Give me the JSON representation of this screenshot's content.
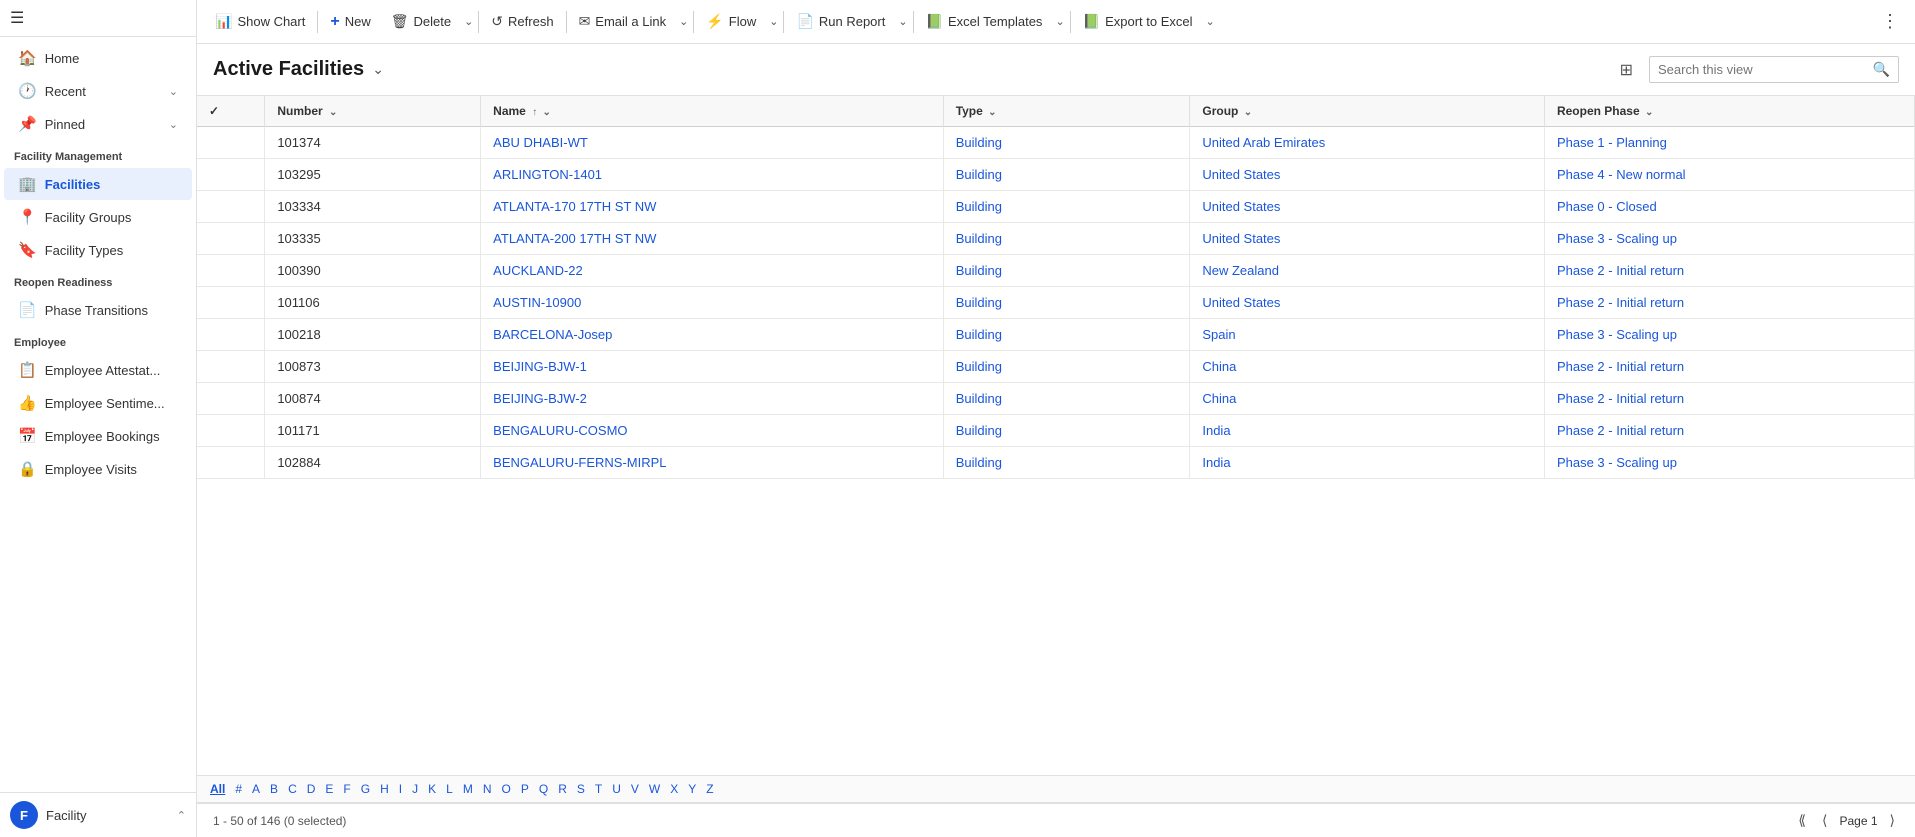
{
  "sidebar": {
    "hamburger_icon": "☰",
    "nav_items": [
      {
        "id": "home",
        "label": "Home",
        "icon": "🏠",
        "has_chevron": false
      },
      {
        "id": "recent",
        "label": "Recent",
        "icon": "🕐",
        "has_chevron": true
      },
      {
        "id": "pinned",
        "label": "Pinned",
        "icon": "📌",
        "has_chevron": true
      }
    ],
    "sections": [
      {
        "title": "Facility Management",
        "items": [
          {
            "id": "facilities",
            "label": "Facilities",
            "icon": "🏢",
            "active": true
          },
          {
            "id": "facility-groups",
            "label": "Facility Groups",
            "icon": "📍"
          },
          {
            "id": "facility-types",
            "label": "Facility Types",
            "icon": "🔖"
          }
        ]
      },
      {
        "title": "Reopen Readiness",
        "items": [
          {
            "id": "phase-transitions",
            "label": "Phase Transitions",
            "icon": "📄"
          }
        ]
      },
      {
        "title": "Employee",
        "items": [
          {
            "id": "employee-attestat",
            "label": "Employee Attestat...",
            "icon": "📋"
          },
          {
            "id": "employee-sentime",
            "label": "Employee Sentime...",
            "icon": "👍"
          },
          {
            "id": "employee-bookings",
            "label": "Employee Bookings",
            "icon": "📅"
          },
          {
            "id": "employee-visits",
            "label": "Employee Visits",
            "icon": "🔒"
          }
        ]
      }
    ],
    "footer": {
      "avatar_letter": "F",
      "label": "Facility",
      "chevron": "⌃"
    }
  },
  "toolbar": {
    "buttons": [
      {
        "id": "show-chart",
        "icon": "📊",
        "label": "Show Chart",
        "has_chevron": false
      },
      {
        "id": "new",
        "icon": "+",
        "label": "New",
        "has_chevron": false
      },
      {
        "id": "delete",
        "icon": "🗑",
        "label": "Delete",
        "has_chevron": true
      },
      {
        "id": "refresh",
        "icon": "↺",
        "label": "Refresh",
        "has_chevron": false
      },
      {
        "id": "email-link",
        "icon": "✉",
        "label": "Email a Link",
        "has_chevron": true
      },
      {
        "id": "flow",
        "icon": "⚡",
        "label": "Flow",
        "has_chevron": true
      },
      {
        "id": "run-report",
        "icon": "📄",
        "label": "Run Report",
        "has_chevron": true
      },
      {
        "id": "excel-templates",
        "icon": "📗",
        "label": "Excel Templates",
        "has_chevron": true
      },
      {
        "id": "export-excel",
        "icon": "📗",
        "label": "Export to Excel",
        "has_chevron": true
      }
    ],
    "more_icon": "⋮"
  },
  "view": {
    "title": "Active Facilities",
    "title_chevron": "⌄",
    "filter_icon": "⊞",
    "search_placeholder": "Search this view",
    "search_icon": "🔍"
  },
  "table": {
    "columns": [
      {
        "id": "checkbox",
        "label": "✓",
        "sortable": false
      },
      {
        "id": "number",
        "label": "Number",
        "sort": "⌄",
        "has_chevron": true
      },
      {
        "id": "name",
        "label": "Name",
        "sort": "↑",
        "has_chevron": true
      },
      {
        "id": "type",
        "label": "Type",
        "sort": "",
        "has_chevron": true
      },
      {
        "id": "group",
        "label": "Group",
        "sort": "",
        "has_chevron": true
      },
      {
        "id": "reopen_phase",
        "label": "Reopen Phase",
        "sort": "",
        "has_chevron": true
      }
    ],
    "rows": [
      {
        "number": "101374",
        "name": "ABU DHABI-WT",
        "type": "Building",
        "group": "United Arab Emirates",
        "reopen_phase": "Phase 1 - Planning"
      },
      {
        "number": "103295",
        "name": "ARLINGTON-1401",
        "type": "Building",
        "group": "United States",
        "reopen_phase": "Phase 4 - New normal"
      },
      {
        "number": "103334",
        "name": "ATLANTA-170 17TH ST NW",
        "type": "Building",
        "group": "United States",
        "reopen_phase": "Phase 0 - Closed"
      },
      {
        "number": "103335",
        "name": "ATLANTA-200 17TH ST NW",
        "type": "Building",
        "group": "United States",
        "reopen_phase": "Phase 3 - Scaling up"
      },
      {
        "number": "100390",
        "name": "AUCKLAND-22",
        "type": "Building",
        "group": "New Zealand",
        "reopen_phase": "Phase 2 - Initial return"
      },
      {
        "number": "101106",
        "name": "AUSTIN-10900",
        "type": "Building",
        "group": "United States",
        "reopen_phase": "Phase 2 - Initial return"
      },
      {
        "number": "100218",
        "name": "BARCELONA-Josep",
        "type": "Building",
        "group": "Spain",
        "reopen_phase": "Phase 3 - Scaling up"
      },
      {
        "number": "100873",
        "name": "BEIJING-BJW-1",
        "type": "Building",
        "group": "China",
        "reopen_phase": "Phase 2 - Initial return"
      },
      {
        "number": "100874",
        "name": "BEIJING-BJW-2",
        "type": "Building",
        "group": "China",
        "reopen_phase": "Phase 2 - Initial return"
      },
      {
        "number": "101171",
        "name": "BENGALURU-COSMO",
        "type": "Building",
        "group": "India",
        "reopen_phase": "Phase 2 - Initial return"
      },
      {
        "number": "102884",
        "name": "BENGALURU-FERNS-MIRPL",
        "type": "Building",
        "group": "India",
        "reopen_phase": "Phase 3 - Scaling up"
      }
    ]
  },
  "alpha_bar": {
    "items": [
      "All",
      "#",
      "A",
      "B",
      "C",
      "D",
      "E",
      "F",
      "G",
      "H",
      "I",
      "J",
      "K",
      "L",
      "M",
      "N",
      "O",
      "P",
      "Q",
      "R",
      "S",
      "T",
      "U",
      "V",
      "W",
      "X",
      "Y",
      "Z"
    ]
  },
  "footer": {
    "record_info": "1 - 50 of 146 (0 selected)",
    "first_icon": "⟪",
    "prev_icon": "⟨",
    "page_label": "Page 1",
    "next_icon": "⟩"
  }
}
